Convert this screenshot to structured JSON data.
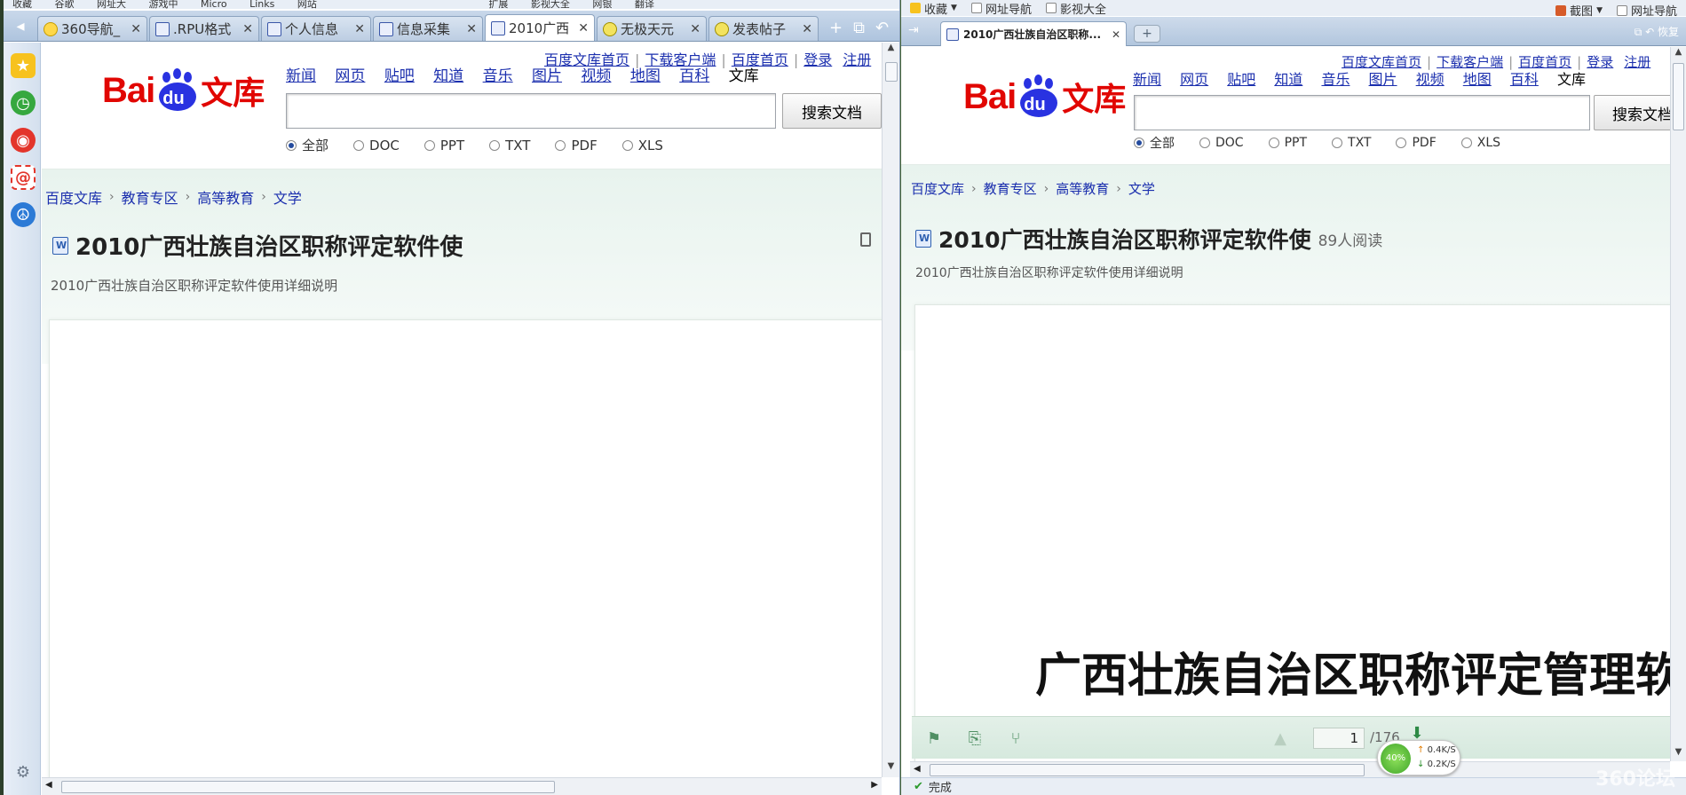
{
  "left": {
    "favorites_bar": [
      "收藏",
      "谷歌",
      "网址大",
      "游戏中",
      "Micro",
      "Links",
      "网站",
      "扩展",
      "影视大全",
      "网银",
      "翻译"
    ],
    "tabs": [
      {
        "label": "360导航_",
        "active": false
      },
      {
        "label": ".RPU格式",
        "active": false
      },
      {
        "label": "个人信息",
        "active": false
      },
      {
        "label": "信息采集",
        "active": false
      },
      {
        "label": "2010广西",
        "active": true
      },
      {
        "label": "无极天元",
        "active": false
      },
      {
        "label": "发表帖子",
        "active": false
      }
    ]
  },
  "baidu": {
    "top_links": [
      "百度文库首页",
      "下载客户端",
      "百度首页",
      "登录",
      "注册"
    ],
    "logo_bai": "Bai",
    "logo_du": "du",
    "logo_wenku": "文库",
    "nav": [
      "新闻",
      "网页",
      "贴吧",
      "知道",
      "音乐",
      "图片",
      "视频",
      "地图",
      "百科",
      "文库"
    ],
    "search_button": "搜索文档",
    "radios": [
      {
        "label": "全部",
        "checked": true
      },
      {
        "label": "DOC",
        "checked": false
      },
      {
        "label": "PPT",
        "checked": false
      },
      {
        "label": "TXT",
        "checked": false
      },
      {
        "label": "PDF",
        "checked": false
      },
      {
        "label": "XLS",
        "checked": false
      }
    ],
    "breadcrumbs": [
      "百度文库",
      "教育专区",
      "高等教育",
      "文学"
    ],
    "doc_title": "2010广西壮族自治区职称评定软件使",
    "reads": "89人阅读",
    "doc_desc": "2010广西壮族自治区职称评定软件使用详细说明",
    "doc_content_heading": "广西壮族自治区职称评定管理软"
  },
  "right": {
    "menubar": {
      "favorites": "收藏",
      "nav": "网址导航",
      "video": "影视大全",
      "screenshot": "截图",
      "nav2": "网址导航"
    },
    "tab_label": "2010广西壮族自治区职称...",
    "restore": "恢复",
    "page_current": "1",
    "page_total": "/176",
    "status": "完成",
    "speed": {
      "percent": "40%",
      "up": "0.4K/S",
      "down": "0.2K/S"
    },
    "watermark": "360论坛"
  }
}
